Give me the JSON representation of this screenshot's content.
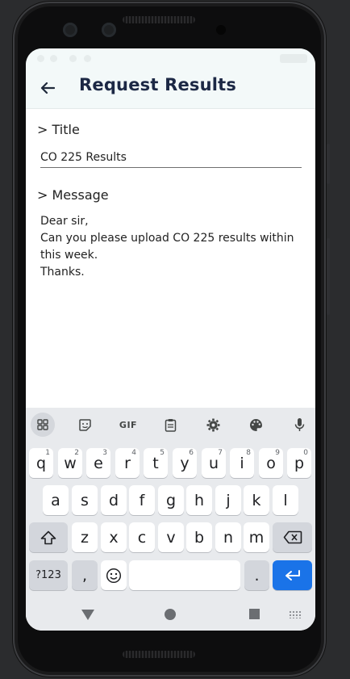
{
  "app": {
    "page_title": "Request Results",
    "back_icon": "arrow-back-icon"
  },
  "form": {
    "title_label": "> Title",
    "title_value": "CO 225 Results",
    "message_label": "> Message",
    "message_value": "Dear sir,\nCan you please upload CO 225 results within this week.\nThanks."
  },
  "keyboard": {
    "toolbar": {
      "icons": [
        "apps-grid-icon",
        "sticker-icon",
        "gif-icon",
        "clipboard-icon",
        "settings-gear-icon",
        "palette-icon",
        "microphone-icon"
      ],
      "gif_label": "GIF"
    },
    "row1": [
      {
        "key": "q",
        "hint": "1"
      },
      {
        "key": "w",
        "hint": "2"
      },
      {
        "key": "e",
        "hint": "3"
      },
      {
        "key": "r",
        "hint": "4"
      },
      {
        "key": "t",
        "hint": "5"
      },
      {
        "key": "y",
        "hint": "6"
      },
      {
        "key": "u",
        "hint": "7"
      },
      {
        "key": "i",
        "hint": "8"
      },
      {
        "key": "o",
        "hint": "9"
      },
      {
        "key": "p",
        "hint": "0"
      }
    ],
    "row2": [
      "a",
      "s",
      "d",
      "f",
      "g",
      "h",
      "j",
      "k",
      "l"
    ],
    "row3": [
      "z",
      "x",
      "c",
      "v",
      "b",
      "n",
      "m"
    ],
    "symbols_key": "?123",
    "comma_key": ",",
    "period_key": ".",
    "accent_color": "#1a73e8"
  },
  "nav": {
    "icons": [
      "nav-back-icon",
      "nav-home-icon",
      "nav-recents-icon",
      "keyboard-switch-icon"
    ]
  }
}
